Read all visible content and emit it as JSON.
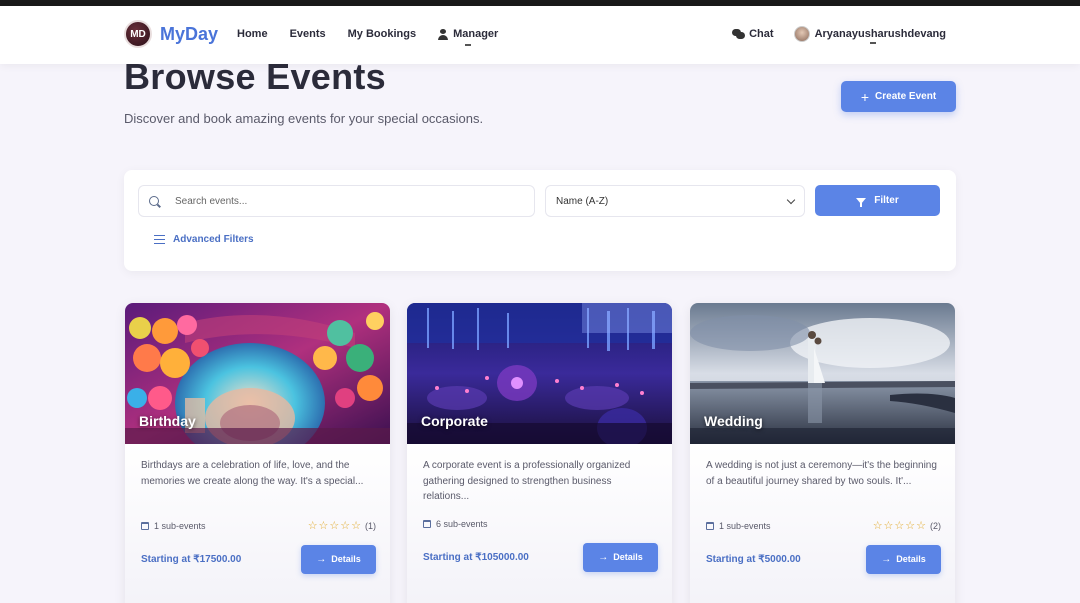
{
  "nav": {
    "logo_text": "MD",
    "brand": "MyDay",
    "links": [
      "Home",
      "Events",
      "My Bookings",
      "Manager"
    ],
    "chat": "Chat",
    "user_name": "Aryanayusharushdevang"
  },
  "header": {
    "title": "Browse Events",
    "subtitle": "Discover and book amazing events for your special occasions.",
    "create_button": "Create Event"
  },
  "filters": {
    "search_placeholder": "Search events...",
    "sort_selected": "Name (A-Z)",
    "filter_button": "Filter",
    "advanced": "Advanced Filters"
  },
  "events": [
    {
      "title": "Birthday",
      "description": "Birthdays are a celebration of life, love, and the memories we create along the way. It's a special...",
      "sub_events": "1 sub-events",
      "stars": "☆☆☆☆☆",
      "rating_count": "(1)",
      "price": "Starting at ₹17500.00",
      "details": "Details"
    },
    {
      "title": "Corporate",
      "description": "A corporate event is a professionally organized gathering designed to strengthen business relations...",
      "sub_events": "6 sub-events",
      "stars": "",
      "rating_count": "",
      "price": "Starting at ₹105000.00",
      "details": "Details"
    },
    {
      "title": "Wedding",
      "description": "A wedding is not just a ceremony—it's the beginning of a beautiful journey shared by two souls. It'...",
      "sub_events": "1 sub-events",
      "stars": "☆☆☆☆☆",
      "rating_count": "(2)",
      "price": "Starting at ₹5000.00",
      "details": "Details"
    }
  ],
  "colors": {
    "accent": "#5b84e6",
    "brand": "#4a74d9",
    "background": "#f6f4fb",
    "star": "#e2a92b"
  }
}
